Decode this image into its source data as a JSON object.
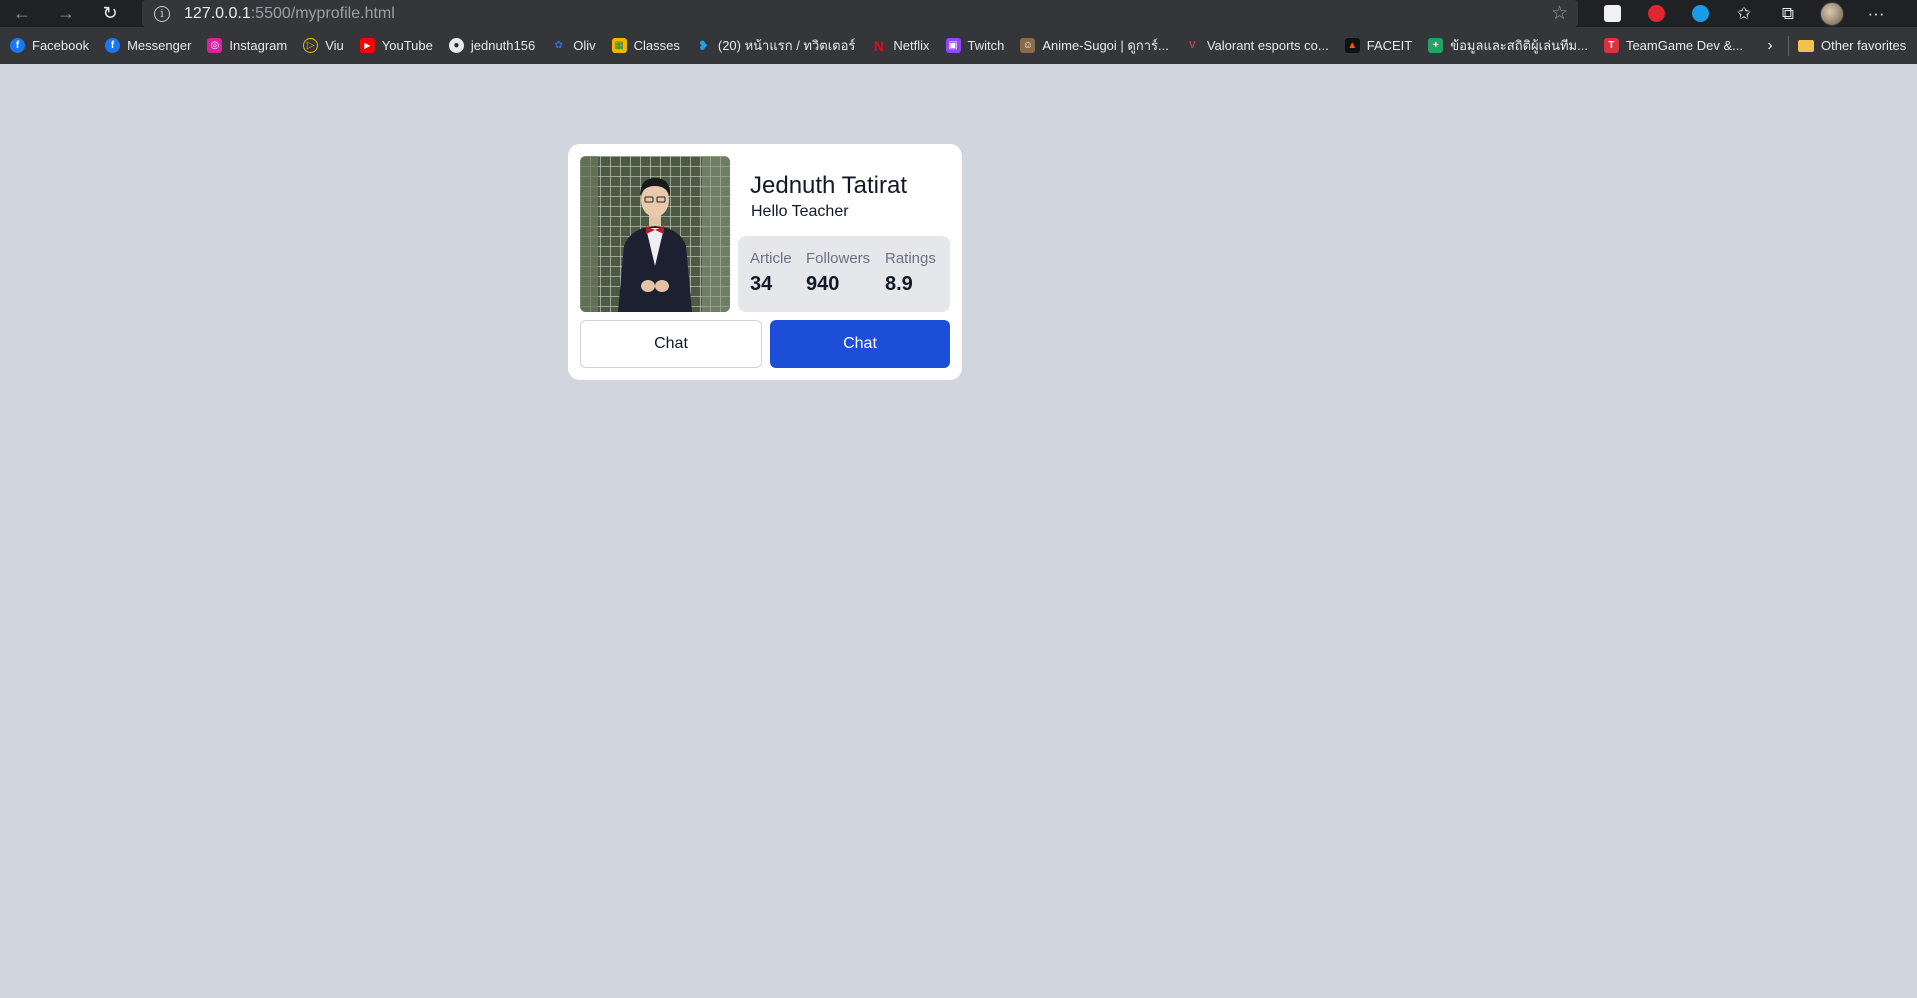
{
  "browser": {
    "url_host": "127.0.0.1",
    "url_path": ":5500/myprofile.html",
    "info_icon": "i",
    "star_icon": "star-icon"
  },
  "bookmarks": [
    {
      "label": "Facebook",
      "color": "#1877f2",
      "glyph": "f"
    },
    {
      "label": "Messenger",
      "color": "#1877f2",
      "glyph": "f"
    },
    {
      "label": "Instagram",
      "color": "#d6249f",
      "glyph": "◎"
    },
    {
      "label": "Viu",
      "color": "#f5b700",
      "glyph": "▷"
    },
    {
      "label": "YouTube",
      "color": "#ff0000",
      "glyph": "▶"
    },
    {
      "label": "jednuth156",
      "color": "#24292e",
      "glyph": "●"
    },
    {
      "label": "Oliv",
      "color": "#2f6fdb",
      "glyph": "✿"
    },
    {
      "label": "Classes",
      "color": "#f4b400",
      "glyph": "▦"
    },
    {
      "label": "(20) หน้าแรก / ทวิตเตอร์",
      "color": "#1da1f2",
      "glyph": "🐦"
    },
    {
      "label": "Netflix",
      "color": "#e50914",
      "glyph": "N"
    },
    {
      "label": "Twitch",
      "color": "#9146ff",
      "glyph": "▣"
    },
    {
      "label": "Anime-Sugoi | ดูการ์...",
      "color": "#8b6b4a",
      "glyph": "☺"
    },
    {
      "label": "Valorant esports co...",
      "color": "#c9394a",
      "glyph": "V"
    },
    {
      "label": "FACEIT",
      "color": "#ff5500",
      "glyph": "▲"
    },
    {
      "label": "ข้อมูลและสถิติผู้เล่นทีม...",
      "color": "#21a366",
      "glyph": "+"
    },
    {
      "label": "TeamGame Dev &...",
      "color": "#d8343f",
      "glyph": "T"
    }
  ],
  "bookmarks_more": "›",
  "other_favorites": "Other favorites",
  "profile": {
    "name": "Jednuth Tatirat",
    "subtitle": "Hello Teacher",
    "stats": [
      {
        "label": "Article",
        "value": "34"
      },
      {
        "label": "Followers",
        "value": "940"
      },
      {
        "label": "Ratings",
        "value": "8.9"
      }
    ],
    "buttons": {
      "outline_label": "Chat",
      "primary_label": "Chat"
    }
  },
  "colors": {
    "page_bg": "#d1d5de",
    "primary": "#1d4ed8",
    "stats_bg": "#e5e7eb"
  }
}
